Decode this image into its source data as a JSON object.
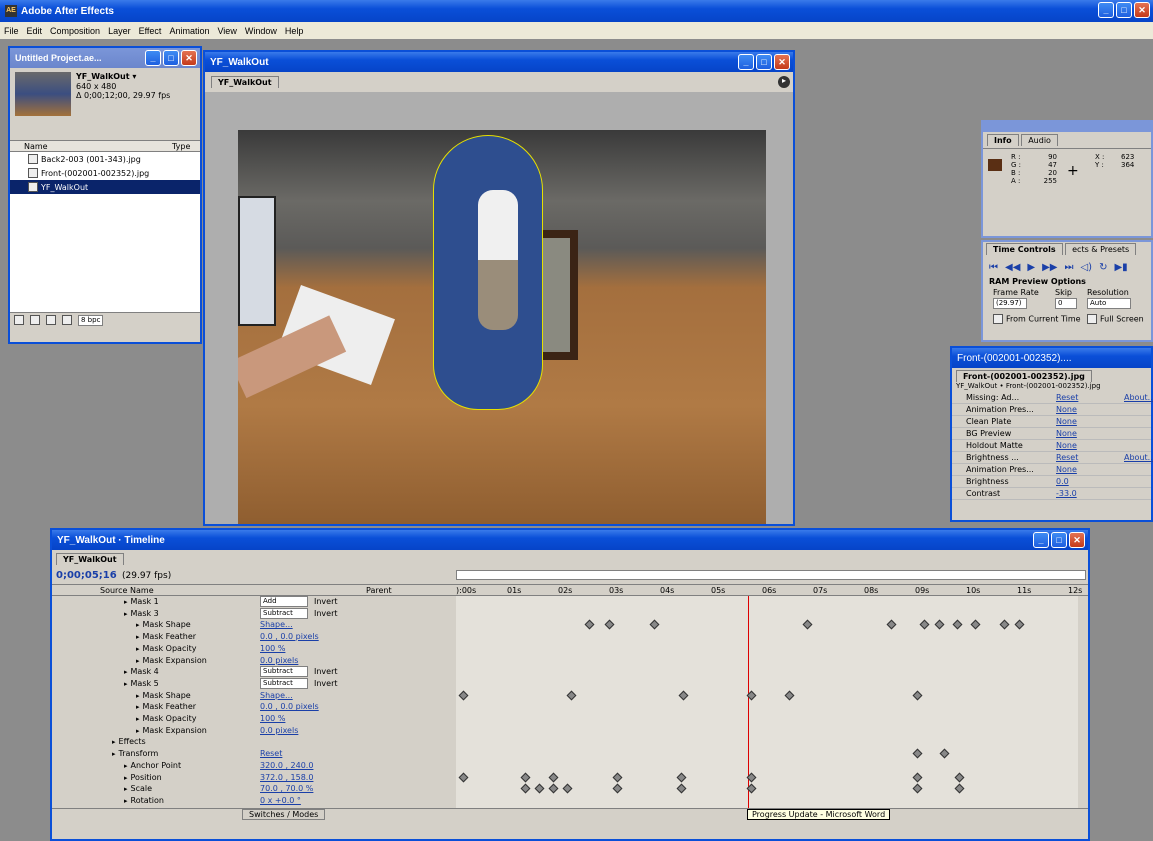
{
  "app": {
    "title": "Adobe After Effects"
  },
  "menu": [
    "File",
    "Edit",
    "Composition",
    "Layer",
    "Effect",
    "Animation",
    "View",
    "Window",
    "Help"
  ],
  "project": {
    "title": "Untitled Project.ae...",
    "comp_name": "YF_WalkOut ▾",
    "comp_size": "640 x 480",
    "comp_duration": "Δ 0;00;12;00, 29.97 fps",
    "col_name": "Name",
    "col_type": "Type",
    "items": [
      "Back2-003 (001-343).jpg",
      "Front-(002001-002352).jpg",
      "YF_WalkOut"
    ],
    "footer_bpc": "8 bpc"
  },
  "comp_window": {
    "title": "YF_WalkOut",
    "tab": "YF_WalkOut"
  },
  "info": {
    "tab_info": "Info",
    "tab_audio": "Audio",
    "r_label": "R :",
    "r": "90",
    "g_label": "G :",
    "g": "47",
    "b_label": "B :",
    "b": "20",
    "a_label": "A :",
    "a": "255",
    "x_label": "X :",
    "x": "623",
    "y_label": "Y :",
    "y": "364",
    "swatch": "#5a2f14"
  },
  "time_controls": {
    "tab1": "Time Controls",
    "tab2": "ects & Presets",
    "ram_title": "RAM Preview Options",
    "frame_rate_label": "Frame Rate",
    "skip_label": "Skip",
    "resolution_label": "Resolution",
    "frame_rate": "(29.97)",
    "skip": "0",
    "resolution": "Auto",
    "from_current": "From Current Time",
    "full_screen": "Full Screen"
  },
  "effects_window": {
    "title": "Front-(002001-002352)....",
    "tab": "Front-(002001-002352).jpg",
    "subtitle": "YF_WalkOut • Front-(002001-002352).jpg",
    "rows": [
      {
        "name": "Missing: Ad...",
        "value": "Reset",
        "extra": "About..."
      },
      {
        "name": "Animation Pres...",
        "value": "None"
      },
      {
        "name": "Clean Plate",
        "value": "None"
      },
      {
        "name": "BG Preview",
        "value": "None"
      },
      {
        "name": "Holdout Matte",
        "value": "None"
      },
      {
        "name": "Brightness ...",
        "value": "Reset",
        "extra": "About..."
      },
      {
        "name": "Animation Pres...",
        "value": "None"
      },
      {
        "name": "Brightness",
        "value": "0.0"
      },
      {
        "name": "Contrast",
        "value": "-33.0"
      }
    ]
  },
  "timeline": {
    "title": "YF_WalkOut · Timeline",
    "tab": "YF_WalkOut",
    "timecode": "0;00;05;16",
    "fps": "(29.97 fps)",
    "col_source": "Source Name",
    "col_parent": "Parent",
    "ruler": [
      "):00s",
      "01s",
      "02s",
      "03s",
      "04s",
      "05s",
      "06s",
      "07s",
      "08s",
      "09s",
      "10s",
      "11s",
      "12s"
    ],
    "switches_modes": "Switches / Modes",
    "taskbar_tip": "Progress Update - Microsoft Word",
    "layers": [
      {
        "indent": 1,
        "label": "Mask 1",
        "mode": "Add",
        "extra": "Invert"
      },
      {
        "indent": 1,
        "label": "Mask 3",
        "mode": "Subtract",
        "extra": "Invert"
      },
      {
        "indent": 2,
        "label": "Mask Shape",
        "value": "Shape..."
      },
      {
        "indent": 2,
        "label": "Mask Feather",
        "value": "0.0 , 0.0 pixels"
      },
      {
        "indent": 2,
        "label": "Mask Opacity",
        "value": "100 %"
      },
      {
        "indent": 2,
        "label": "Mask Expansion",
        "value": "0.0 pixels"
      },
      {
        "indent": 1,
        "label": "Mask 4",
        "mode": "Subtract",
        "extra": "Invert"
      },
      {
        "indent": 1,
        "label": "Mask 5",
        "mode": "Subtract",
        "extra": "Invert"
      },
      {
        "indent": 2,
        "label": "Mask Shape",
        "value": "Shape..."
      },
      {
        "indent": 2,
        "label": "Mask Feather",
        "value": "0.0 , 0.0 pixels"
      },
      {
        "indent": 2,
        "label": "Mask Opacity",
        "value": "100 %"
      },
      {
        "indent": 2,
        "label": "Mask Expansion",
        "value": "0.0 pixels"
      },
      {
        "indent": 0,
        "label": "Effects"
      },
      {
        "indent": 0,
        "label": "Transform",
        "value": "Reset"
      },
      {
        "indent": 1,
        "label": "Anchor Point",
        "value": "320.0 , 240.0"
      },
      {
        "indent": 1,
        "label": "Position",
        "value": "372.0 , 158.0"
      },
      {
        "indent": 1,
        "label": "Scale",
        "value": "70.0 , 70.0 %"
      },
      {
        "indent": 1,
        "label": "Rotation",
        "value": "0 x +0.0 °"
      }
    ]
  }
}
